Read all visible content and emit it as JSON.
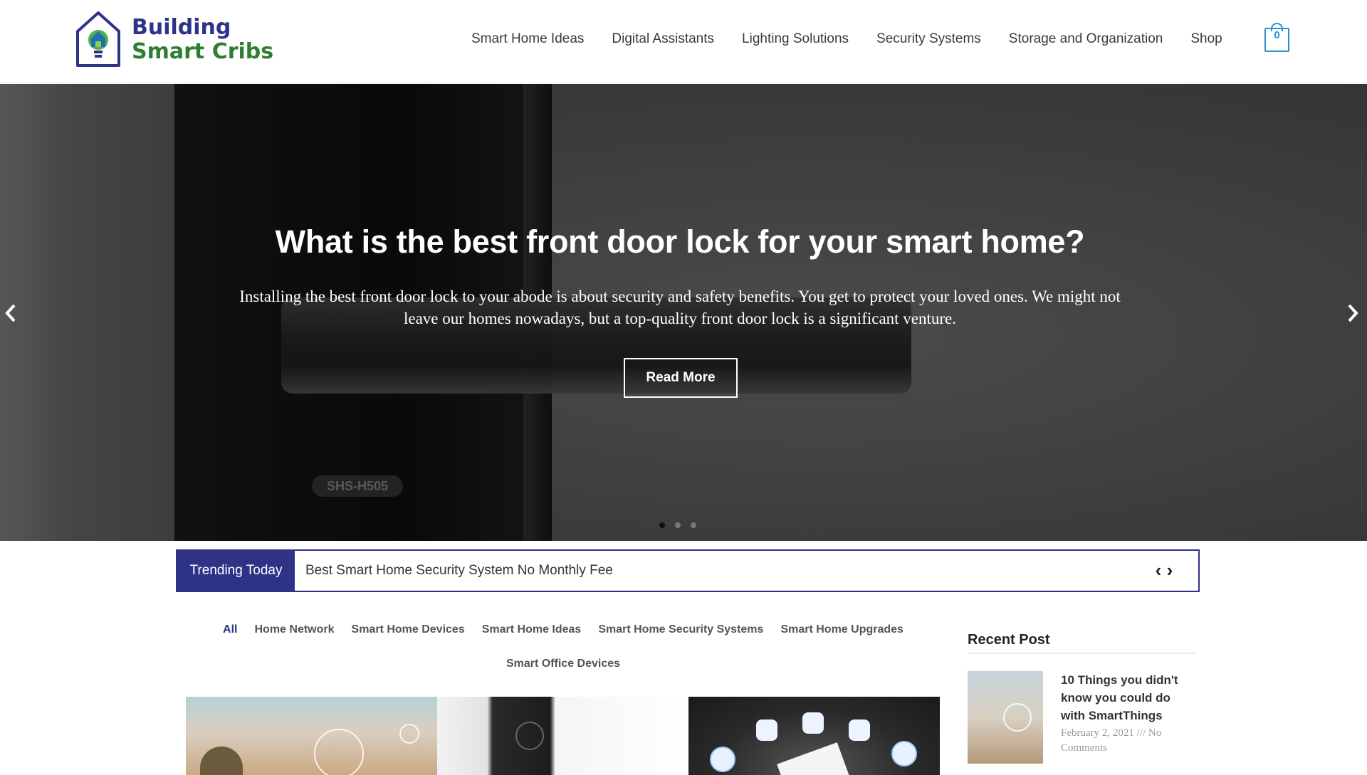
{
  "brand": {
    "name_line1": "Building",
    "name_line2": "Smart Cribs",
    "colors": {
      "primary": "#2e3388",
      "secondary": "#2f7d32",
      "accent": "#2c8fd0"
    }
  },
  "nav": {
    "items": [
      {
        "label": "Smart Home Ideas"
      },
      {
        "label": "Digital Assistants"
      },
      {
        "label": "Lighting Solutions"
      },
      {
        "label": "Security Systems"
      },
      {
        "label": "Storage and Organization"
      },
      {
        "label": "Shop"
      }
    ],
    "cart_count": "0",
    "cart_icon": "shopping-bag-icon"
  },
  "hero": {
    "title": "What is the best front door lock for your smart home?",
    "text": "Installing the best front door lock to your abode is about security and safety benefits. You get to protect your loved ones. We might not leave our homes nowadays, but a top-quality front door lock is a significant venture.",
    "button": "Read More",
    "image_label": "SHS-H505",
    "prev_icon": "chevron-left-icon",
    "next_icon": "chevron-right-icon",
    "slide_count": 3,
    "active_slide": 1
  },
  "trending": {
    "label": "Trending Today",
    "headline": "Best Smart Home Security System No Monthly Fee",
    "prev_glyph": "‹",
    "next_glyph": "›"
  },
  "filters": {
    "row1": [
      "All",
      "Home Network",
      "Smart Home Devices",
      "Smart Home Ideas",
      "Smart Home Security Systems",
      "Smart Home Upgrades"
    ],
    "row2": [
      "Smart Office Devices"
    ],
    "active": "All"
  },
  "sidebar": {
    "title": "Recent Post",
    "posts": [
      {
        "title": "10 Things you didn't know you could do with SmartThings",
        "meta": "February 2, 2021 /// No Comments"
      }
    ]
  }
}
